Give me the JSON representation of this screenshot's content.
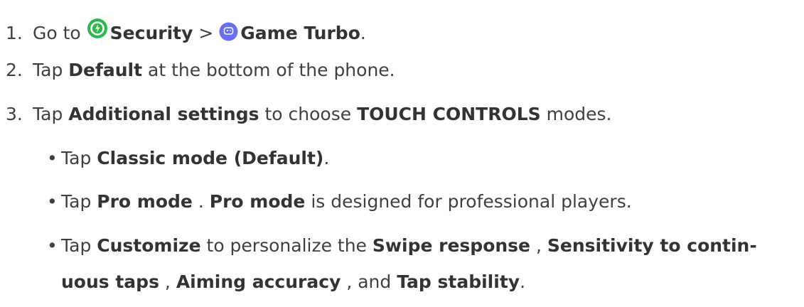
{
  "steps": [
    {
      "num": "1.",
      "t1": "Go to",
      "t2": "Security",
      "t3": ">",
      "t4": "Game Turbo",
      "t5": "."
    },
    {
      "num": "2.",
      "t1": "Tap",
      "t2": "Default",
      "t3": "at the bottom of the phone."
    },
    {
      "num": "3.",
      "t1": "Tap",
      "t2": "Additional settings",
      "t3": "to choose",
      "t4": "TOUCH CONTROLS",
      "t5": "modes."
    }
  ],
  "bullets": [
    {
      "mark": "•",
      "t1": "Tap",
      "t2": "Classic mode (Default)",
      "t3": "."
    },
    {
      "mark": "•",
      "t1": "Tap",
      "t2": "Pro mode",
      "t3": ".",
      "t4": "Pro mode",
      "t5": "is designed for professional players."
    },
    {
      "mark": "•",
      "t1": "Tap",
      "t2": "Customize",
      "t3": "to personalize the",
      "t4": "Swipe response",
      "t5": ",",
      "t6": "Sensitivity to contin-",
      "t7": "uous taps",
      "t8": ",",
      "t9": "Aiming accuracy",
      "t10": ", and",
      "t11": "Tap stability",
      "t12": "."
    }
  ],
  "icons": {
    "security": {
      "name": "security-icon",
      "color": "#2db84d"
    },
    "game_turbo": {
      "name": "game-turbo-icon",
      "color": "#6a6ff0"
    }
  }
}
